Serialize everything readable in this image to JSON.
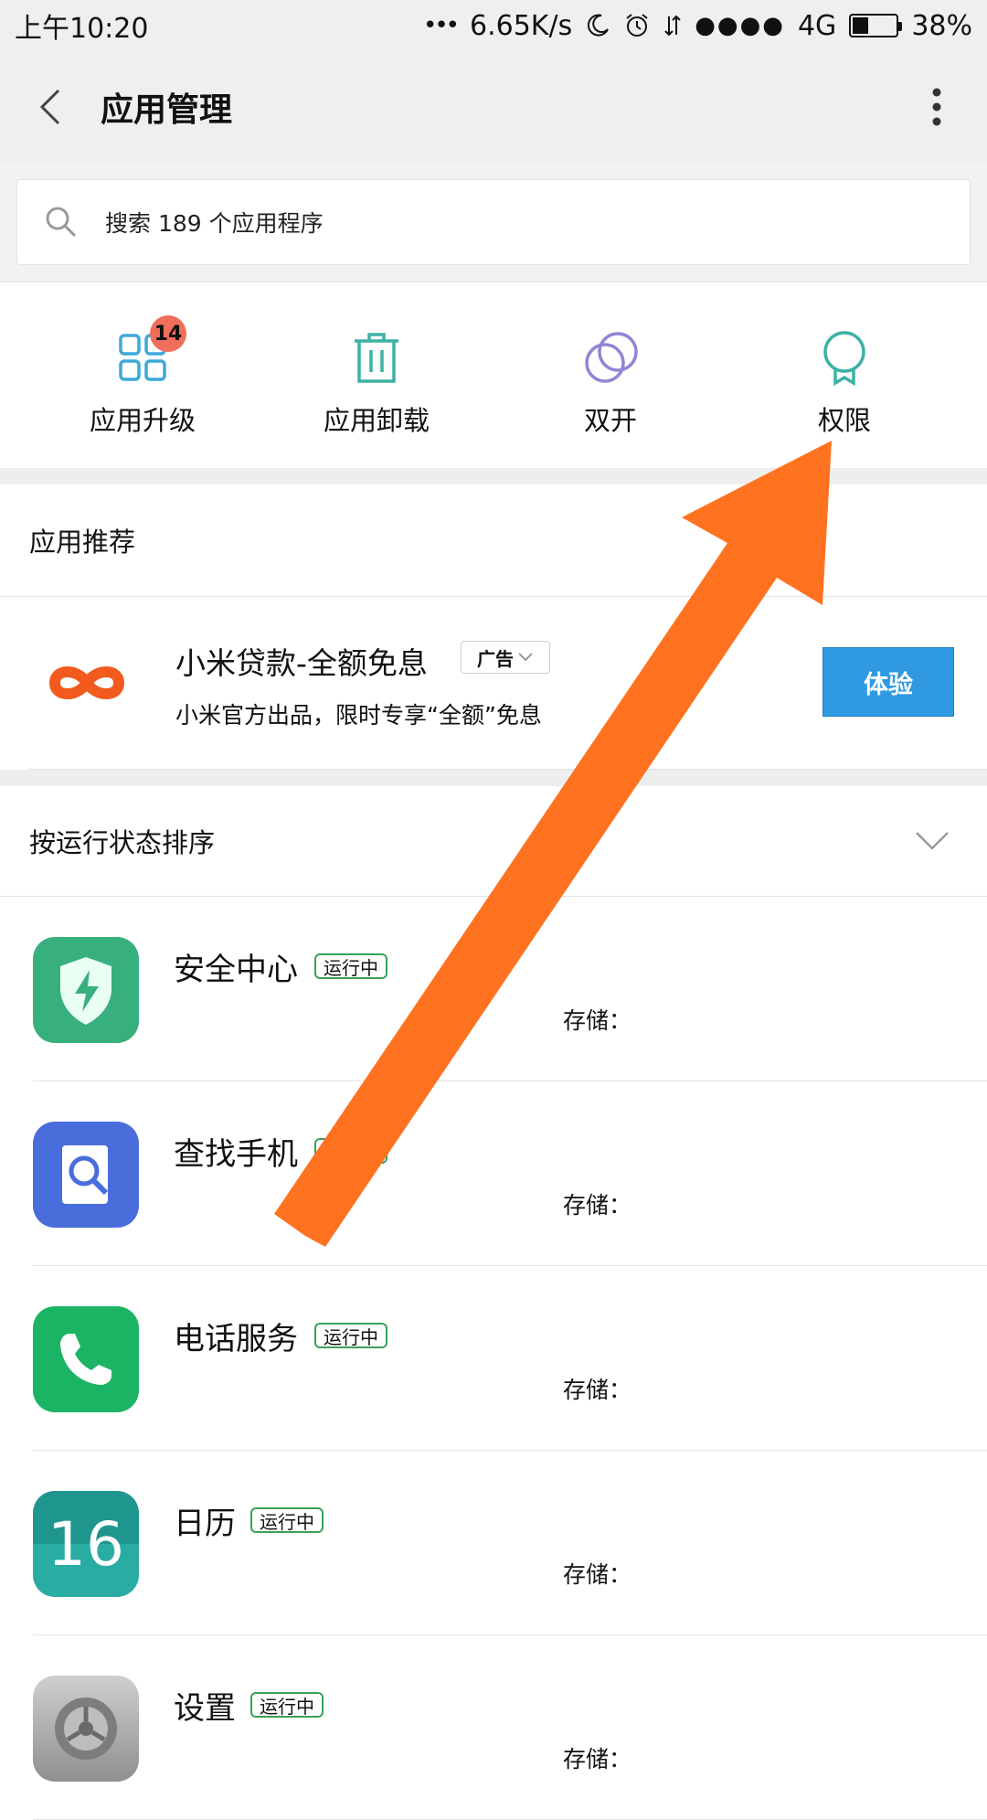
{
  "statusbar": {
    "time": "上午10:20",
    "net_dots": "•••",
    "speed": "6.65K/s",
    "signal_dots": "●●●●",
    "network": "4G",
    "battery": "38%",
    "battery_level": 0.38
  },
  "header": {
    "title": "应用管理"
  },
  "search": {
    "text": "搜索 189 个应用程序"
  },
  "quick_actions": [
    {
      "label": "应用升级",
      "badge": "14",
      "icon": "grid-icon"
    },
    {
      "label": "应用卸载",
      "icon": "trash-icon"
    },
    {
      "label": "双开",
      "icon": "dual-circles-icon"
    },
    {
      "label": "权限",
      "icon": "ribbon-icon"
    }
  ],
  "recommend": {
    "header": "应用推荐",
    "app_name": "小米贷款-全额免息",
    "ad_label": "广告",
    "desc": "小米官方出品，限时专享“全额”免息",
    "button": "体验"
  },
  "sort": {
    "label": "按运行状态排序"
  },
  "apps": [
    {
      "name": "安全中心",
      "status": "运行中",
      "storage": "存储："
    },
    {
      "name": "查找手机",
      "status": "运行中",
      "storage": "存储："
    },
    {
      "name": "电话服务",
      "status": "运行中",
      "storage": "存储："
    },
    {
      "name": "日历",
      "status": "运行中",
      "storage": "存储：",
      "icon_text": "16"
    },
    {
      "name": "设置",
      "status": "运行中",
      "storage": "存储："
    }
  ],
  "colors": {
    "accent_teal": "#3db1a5",
    "accent_blue": "#2f9ae2",
    "badge_red": "#f06e5c",
    "arrow_orange": "#ff7220",
    "running_green": "#3aa05a"
  }
}
